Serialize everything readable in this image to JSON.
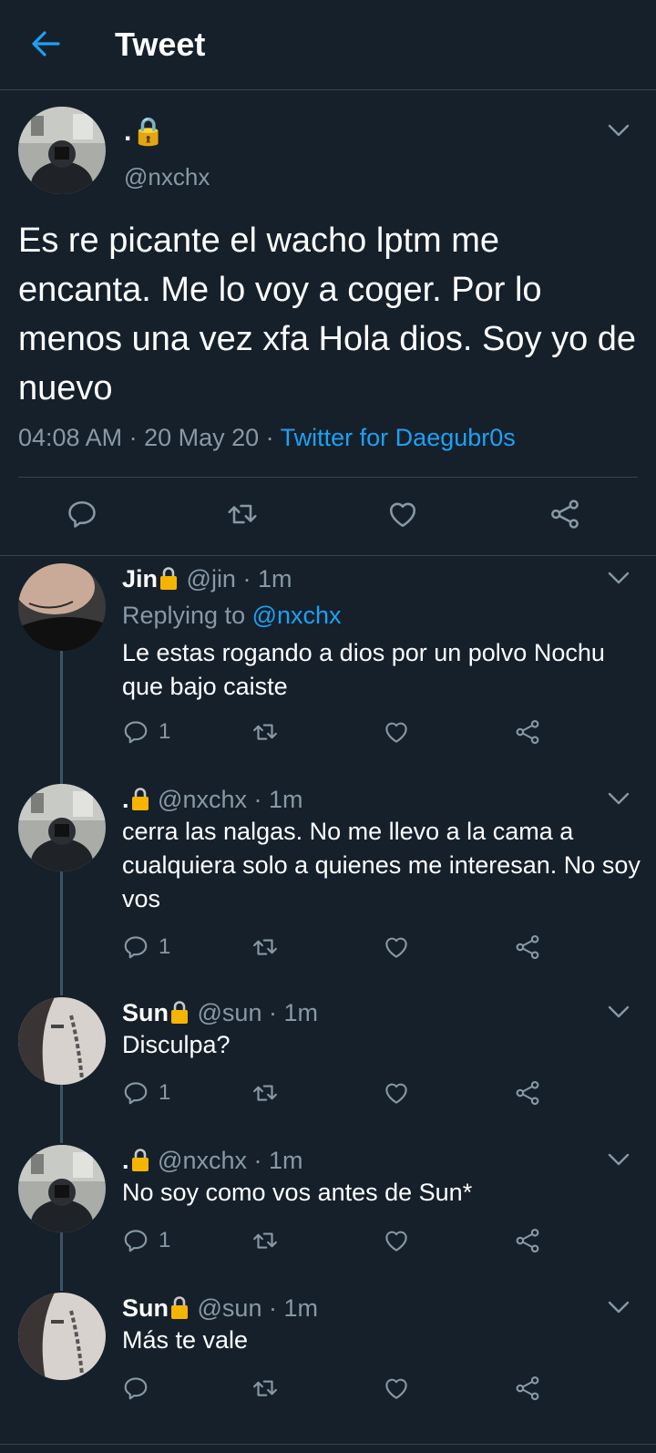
{
  "header": {
    "title": "Tweet"
  },
  "main_tweet": {
    "name": ".🔒",
    "handle": "@nxchx",
    "text": "Es re picante el wacho lptm me encanta. Me lo voy a coger. Por lo menos una vez xfa Hola dios. Soy yo de nuevo",
    "time": "04:08 AM · 20 May 20 · ",
    "source": "Twitter for Daegubr0s"
  },
  "replies": [
    {
      "name": "Jin",
      "handle": "@jin · 1m",
      "replying_label": "Replying to ",
      "replying_to": "@nxchx",
      "text": "Le estas rogando a dios por un polvo Nochu que bajo caiste",
      "reply_count": "1"
    },
    {
      "name": ".",
      "handle": "@nxchx · 1m",
      "text": "cerra las nalgas. No me llevo a la cama a cualquiera solo a quienes me interesan. No soy vos",
      "reply_count": "1"
    },
    {
      "name": "Sun",
      "handle": "@sun · 1m",
      "text": "Disculpa?",
      "reply_count": "1"
    },
    {
      "name": ".",
      "handle": "@nxchx · 1m",
      "text": "No soy como vos antes de Sun*",
      "reply_count": "1"
    },
    {
      "name": "Sun",
      "handle": "@sun · 1m",
      "text": "Más te vale",
      "reply_count": ""
    }
  ],
  "colors": {
    "background": "#15202b",
    "accent": "#1da1f2",
    "secondary_text": "#8899a6",
    "lock": "#f5b400"
  },
  "icons": [
    "back-arrow-icon",
    "chevron-down-icon",
    "reply-icon",
    "retweet-icon",
    "like-icon",
    "share-icon",
    "lock-icon"
  ]
}
